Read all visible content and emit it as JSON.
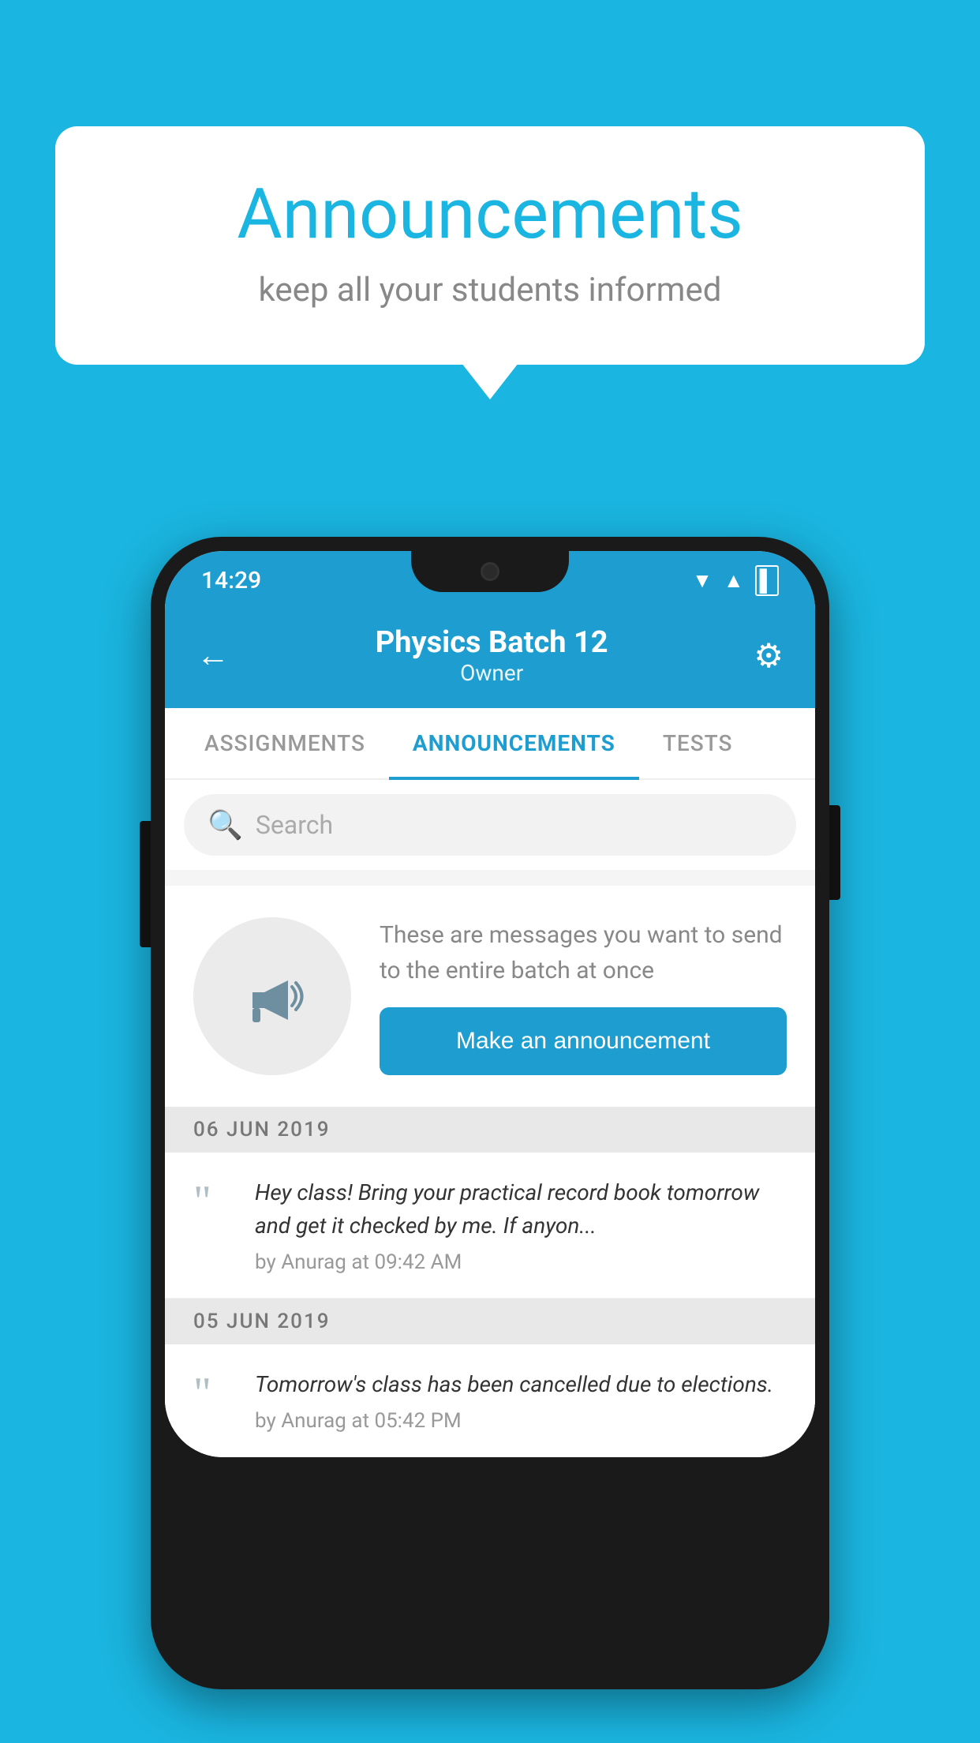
{
  "background_color": "#1ab5e0",
  "speech_bubble": {
    "title": "Announcements",
    "subtitle": "keep all your students informed"
  },
  "status_bar": {
    "time": "14:29",
    "icons": [
      "wifi",
      "signal",
      "battery"
    ]
  },
  "header": {
    "title": "Physics Batch 12",
    "subtitle": "Owner",
    "back_label": "←",
    "gear_label": "⚙"
  },
  "tabs": [
    {
      "label": "ASSIGNMENTS",
      "active": false
    },
    {
      "label": "ANNOUNCEMENTS",
      "active": true
    },
    {
      "label": "TESTS",
      "active": false
    }
  ],
  "search": {
    "placeholder": "Search"
  },
  "announcement_prompt": {
    "description": "These are messages you want to send to the entire batch at once",
    "button_label": "Make an announcement"
  },
  "announcements": [
    {
      "date": "06  JUN  2019",
      "message": "Hey class! Bring your practical record book tomorrow and get it checked by me. If anyon...",
      "meta": "by Anurag at 09:42 AM"
    },
    {
      "date": "05  JUN  2019",
      "message": "Tomorrow's class has been cancelled due to elections.",
      "meta": "by Anurag at 05:42 PM"
    }
  ]
}
